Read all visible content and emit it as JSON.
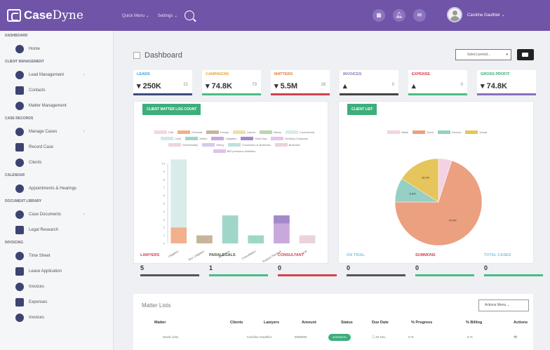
{
  "app": {
    "logo_bold": "Case",
    "logo_light": "Dyne"
  },
  "topbar": {
    "nav": [
      "Quick Menu ⌄",
      "Settings ⌄"
    ],
    "user_name": "Caroline Gauthier ⌄"
  },
  "sidebar": {
    "sections": [
      {
        "title": "Dashboard",
        "items": [
          {
            "label": "Home",
            "icon": "home-icon"
          }
        ]
      },
      {
        "title": "Client Management",
        "items": [
          {
            "label": "Lead Management",
            "icon": "lead-icon",
            "chevron": "›"
          },
          {
            "label": "Contacts",
            "icon": "contacts-icon"
          },
          {
            "label": "Matter Management",
            "icon": "matter-icon"
          }
        ]
      },
      {
        "title": "Case Records",
        "items": [
          {
            "label": "Manage Cases",
            "icon": "briefcase-icon",
            "chevron": "›"
          },
          {
            "label": "Record Case",
            "icon": "record-icon"
          },
          {
            "label": "Clients",
            "icon": "clients-icon"
          }
        ]
      },
      {
        "title": "Calendar",
        "items": [
          {
            "label": "Appointments & Hearings",
            "icon": "calendar-icon"
          }
        ]
      },
      {
        "title": "Document Library",
        "items": [
          {
            "label": "Case Documents",
            "icon": "document-icon",
            "chevron": "›"
          },
          {
            "label": "Legal Research",
            "icon": "research-icon"
          }
        ]
      },
      {
        "title": "Invoicing",
        "items": [
          {
            "label": "Time Sheet",
            "icon": "timesheet-icon"
          },
          {
            "label": "Leave Application",
            "icon": "leave-icon"
          },
          {
            "label": "Invoices",
            "icon": "invoices-icon"
          },
          {
            "label": "Expenses",
            "icon": "expenses-icon"
          },
          {
            "label": "Invoices",
            "icon": "invoice-file-icon"
          }
        ]
      }
    ]
  },
  "dashboard": {
    "title": "Dashboard",
    "period_placeholder": "Select period..."
  },
  "kpis": [
    {
      "label": "Leads",
      "value": "▾ 250K",
      "sub": "21",
      "color": "#3aa0d8"
    },
    {
      "label": "Campaigns",
      "value": "▾ 74.8K",
      "sub": "73",
      "color": "#e8a33a"
    },
    {
      "label": "Matters",
      "value": "▾ 5.5M",
      "sub": "18",
      "color": "#e07b3a"
    },
    {
      "label": "Invoices",
      "value": "▴",
      "sub": "0",
      "color": "#8a76b8"
    },
    {
      "label": "Expense",
      "value": "▴",
      "sub": "0",
      "color": "#d3414f"
    },
    {
      "label": "Gross Profit",
      "value": "▾ 74.8K",
      "sub": "",
      "color": "#3aab6e"
    }
  ],
  "kpi_bar_colors": [
    "#3d4d80",
    "#4bbd84",
    "#d3414f",
    "#444444",
    "#4bbd84",
    "#8a6fbe"
  ],
  "charts": {
    "left_button": "Client Matter Log Count",
    "right_button": "Client List"
  },
  "chart_data": [
    {
      "type": "bar",
      "stacked": true,
      "categories": [
        "Litigation",
        "Bus. Litigation",
        "Arbitration",
        "Consultation",
        "Support Services",
        "ICR"
      ],
      "series": [
        {
          "name": "Civil",
          "color": "#f6d4e4",
          "values": [
            0,
            0,
            0,
            0,
            0,
            0
          ]
        },
        {
          "name": "Criminal",
          "color": "#f2b08c",
          "values": [
            2,
            0,
            0,
            0,
            0,
            0
          ]
        },
        {
          "name": "Family",
          "color": "#c8b49a",
          "values": [
            0,
            1,
            0,
            0,
            0,
            0
          ]
        },
        {
          "name": "Labour",
          "color": "#ede0a8",
          "values": [
            0,
            0,
            0,
            0,
            0,
            0
          ]
        },
        {
          "name": "Ramp",
          "color": "#b9d6b0",
          "values": [
            0,
            0,
            0,
            0,
            0,
            0
          ]
        },
        {
          "name": "Commercial",
          "color": "#d8ecea",
          "values": [
            8.5,
            0,
            0,
            0,
            0,
            0
          ]
        },
        {
          "name": "Land",
          "color": "#cfe8f0",
          "values": [
            0,
            0,
            0,
            0,
            0,
            0
          ]
        },
        {
          "name": "Admin",
          "color": "#9fd6c8",
          "values": [
            0,
            0,
            3.5,
            1,
            0,
            0
          ]
        },
        {
          "name": "Litigation",
          "color": "#c9a9dd",
          "values": [
            0,
            0,
            0,
            0,
            2.5,
            0
          ]
        },
        {
          "name": "Must Day",
          "color": "#a489c9",
          "values": [
            0,
            0,
            0,
            0,
            1,
            0
          ]
        },
        {
          "name": "Dividing Company",
          "color": "#e4c4e9",
          "values": [
            0,
            0,
            0,
            0,
            0,
            0
          ]
        },
        {
          "name": "Intermediary",
          "color": "#f0d4dd",
          "values": [
            0,
            0,
            0,
            0,
            0,
            0
          ]
        },
        {
          "name": "Hiring",
          "color": "#d9c8ef",
          "values": [
            0,
            0,
            0,
            0,
            0,
            0
          ]
        },
        {
          "name": "Conclusion & Business",
          "color": "#bfe0e3",
          "values": [
            0,
            0,
            0,
            0,
            0,
            0
          ]
        },
        {
          "name": "Business",
          "color": "#ead3db",
          "values": [
            0,
            0,
            0,
            0,
            0,
            1
          ]
        },
        {
          "name": "BIR pensions definition",
          "color": "#e0c1ec",
          "values": [
            0,
            0,
            0,
            0,
            0,
            0
          ]
        }
      ],
      "ylim": [
        0,
        10
      ],
      "yticks": [
        0,
        1,
        2,
        3,
        4,
        5,
        6,
        7,
        8,
        9,
        10
      ]
    },
    {
      "type": "pie",
      "labels": [
        "Blank",
        "Good",
        "Divorce",
        "Unsat"
      ],
      "values": [
        0.05,
        0.7,
        0.09,
        0.16
      ],
      "colors": [
        "#f4d2e4",
        "#eba080",
        "#96cfc4",
        "#e6c55c"
      ],
      "slice_labels": [
        "",
        "70.0%",
        "8.8%",
        "16.0%"
      ]
    }
  ],
  "stats": [
    {
      "label": "Lawyers",
      "value": "5",
      "color": "#d3414f",
      "bar": "#555555"
    },
    {
      "label": "Paralegals",
      "value": "1",
      "color": "#3f5b3a",
      "bar": "#4bbd84"
    },
    {
      "label": "Consultant",
      "value": "0",
      "color": "#d3414f",
      "bar": "#d3414f"
    },
    {
      "label": "On Trial",
      "value": "0",
      "color": "#7fc4e6",
      "bar": "#555555"
    },
    {
      "label": "Summons",
      "value": "0",
      "color": "#d3414f",
      "bar": "#4bbd84"
    },
    {
      "label": "Total Cases",
      "value": "0",
      "color": "#7fc4e6",
      "bar": "#4bbd84"
    }
  ],
  "matters": {
    "title": "Matter Lists",
    "actions_label": "Actions Menu ⌄",
    "columns": [
      "Matter",
      "Clients",
      "Lawyers",
      "Amount",
      "Status",
      "Due Date",
      "% Progress",
      "% Billing",
      "Actions"
    ],
    "row": {
      "matter": "David John",
      "lawyer": "Caroline Gauthier",
      "amount": "5000000",
      "status": "ADMISSION",
      "due": "☐ 20 Nov",
      "progress": "0 %",
      "billing": "0 %",
      "action": "👁"
    }
  }
}
